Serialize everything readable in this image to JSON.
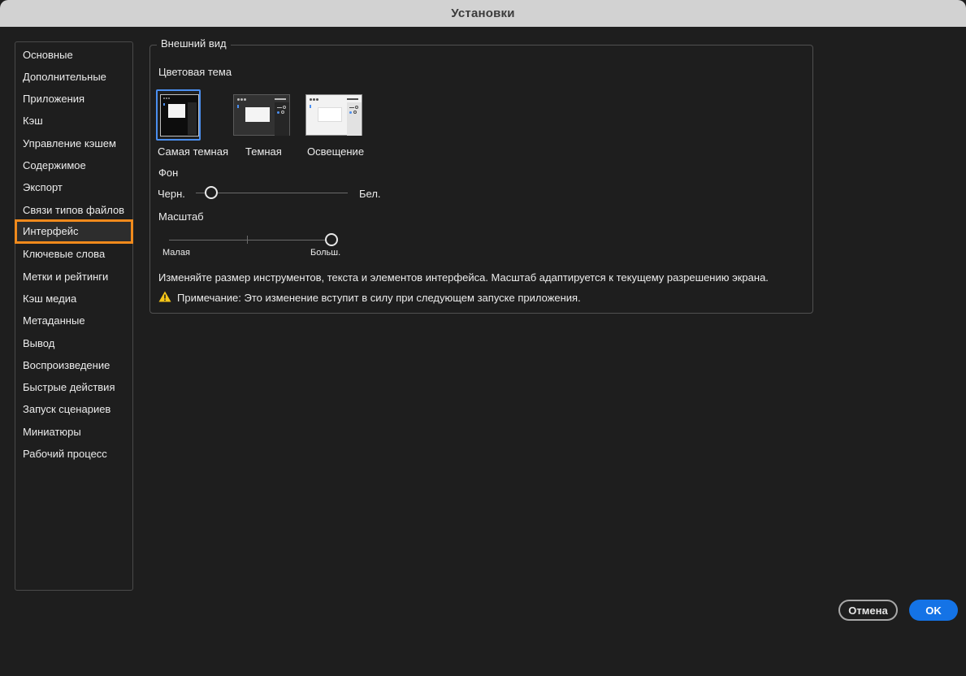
{
  "window": {
    "title": "Установки"
  },
  "sidebar": {
    "items": [
      {
        "label": "Основные"
      },
      {
        "label": "Дополнительные"
      },
      {
        "label": "Приложения"
      },
      {
        "label": "Кэш"
      },
      {
        "label": "Управление кэшем"
      },
      {
        "label": "Содержимое"
      },
      {
        "label": "Экспорт"
      },
      {
        "label": "Связи типов файлов"
      },
      {
        "label": "Интерфейс"
      },
      {
        "label": "Ключевые слова"
      },
      {
        "label": "Метки и рейтинги"
      },
      {
        "label": "Кэш медиа"
      },
      {
        "label": "Метаданные"
      },
      {
        "label": "Вывод"
      },
      {
        "label": "Воспроизведение"
      },
      {
        "label": "Быстрые действия"
      },
      {
        "label": "Запуск сценариев"
      },
      {
        "label": "Миниатюры"
      },
      {
        "label": "Рабочий процесс"
      }
    ],
    "selected": "Интерфейс"
  },
  "appearance": {
    "group_title": "Внешний вид",
    "color_theme_label": "Цветовая тема",
    "themes": [
      {
        "label": "Самая темная"
      },
      {
        "label": "Темная"
      },
      {
        "label": "Освещение"
      }
    ],
    "selected_theme": "Самая темная",
    "background": {
      "label": "Фон",
      "min_label": "Черн.",
      "max_label": "Бел.",
      "value": 0.1
    },
    "scale": {
      "label": "Масштаб",
      "min_label": "Малая",
      "max_label": "Больш.",
      "value": 1.0
    },
    "description": "Изменяйте размер инструментов, текста и элементов интерфейса. Масштаб адаптируется к текущему разрешению экрана.",
    "note": "Примечание: Это изменение вступит в силу при следующем запуске приложения."
  },
  "buttons": {
    "cancel": "Отмена",
    "ok": "OK"
  },
  "colors": {
    "accent": "#1473e6",
    "selection_outline": "#f08a1c",
    "warning": "#f5c518"
  }
}
